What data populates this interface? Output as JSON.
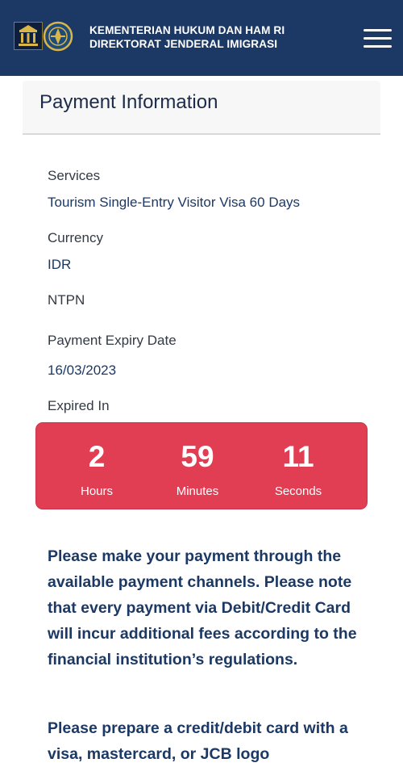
{
  "header": {
    "title_line1": "KEMENTERIAN HUKUM DAN HAM RI",
    "title_line2": "DIREKTORAT JENDERAL IMIGRASI",
    "menu_icon": "hamburger-menu-icon",
    "colors": {
      "background": "#1c3966"
    }
  },
  "card": {
    "title": "Payment Information"
  },
  "details": {
    "services_label": "Services",
    "services_value": "Tourism Single-Entry Visitor Visa 60 Days",
    "currency_label": "Currency",
    "currency_value": "IDR",
    "ntpn_label": "NTPN",
    "expiry_label": "Payment Expiry Date",
    "expiry_value": "16/03/2023",
    "expired_in_label": "Expired In"
  },
  "countdown": {
    "hours": "2",
    "hours_label": "Hours",
    "minutes": "59",
    "minutes_label": "Minutes",
    "seconds": "11",
    "seconds_label": "Seconds",
    "colors": {
      "background": "#e23e53"
    }
  },
  "notices": {
    "notice1": "Please make your payment through the available payment channels. Please note that every payment via Debit/Credit Card will incur additional fees according to the financial institution’s regulations.",
    "notice2": "Please prepare a credit/debit card with a visa, mastercard, or JCB logo"
  }
}
